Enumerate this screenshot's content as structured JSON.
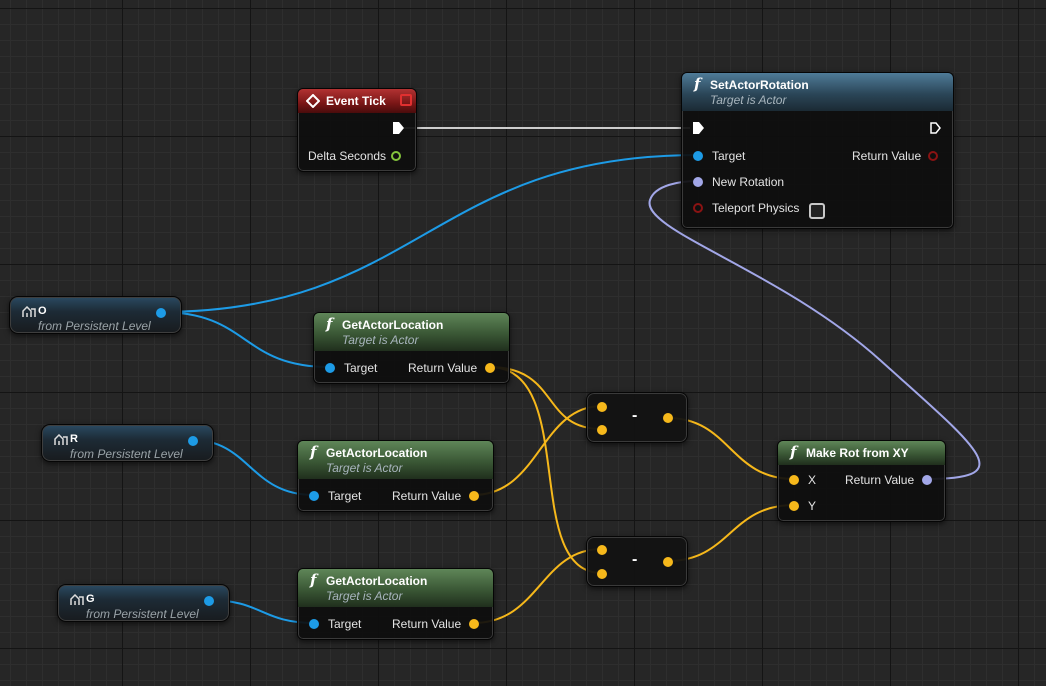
{
  "colors": {
    "object_pin": "#1d9be6",
    "vector_pin": "#f6b81b",
    "rotator_pin": "#a2a7e8",
    "exec_wire": "#cfcfcf"
  },
  "event_tick": {
    "title": "Event Tick",
    "pin_delta": "Delta Seconds"
  },
  "set_actor_rotation": {
    "title": "SetActorRotation",
    "subtitle": "Target is Actor",
    "pin_target": "Target",
    "pin_return": "Return Value",
    "pin_new_rotation": "New Rotation",
    "pin_teleport": "Teleport Physics"
  },
  "variables": [
    {
      "name": "O",
      "source": "from Persistent Level"
    },
    {
      "name": "R",
      "source": "from Persistent Level"
    },
    {
      "name": "G",
      "source": "from Persistent Level"
    }
  ],
  "get_location_nodes": [
    {
      "title": "GetActorLocation",
      "subtitle": "Target is Actor",
      "pin_target": "Target",
      "pin_return": "Return Value"
    },
    {
      "title": "GetActorLocation",
      "subtitle": "Target is Actor",
      "pin_target": "Target",
      "pin_return": "Return Value"
    },
    {
      "title": "GetActorLocation",
      "subtitle": "Target is Actor",
      "pin_target": "Target",
      "pin_return": "Return Value"
    }
  ],
  "subtract_nodes": [
    {
      "symbol": "-"
    },
    {
      "symbol": "-"
    }
  ],
  "make_rot": {
    "title": "Make Rot from XY",
    "pin_x": "X",
    "pin_y": "Y",
    "pin_return": "Return Value"
  }
}
